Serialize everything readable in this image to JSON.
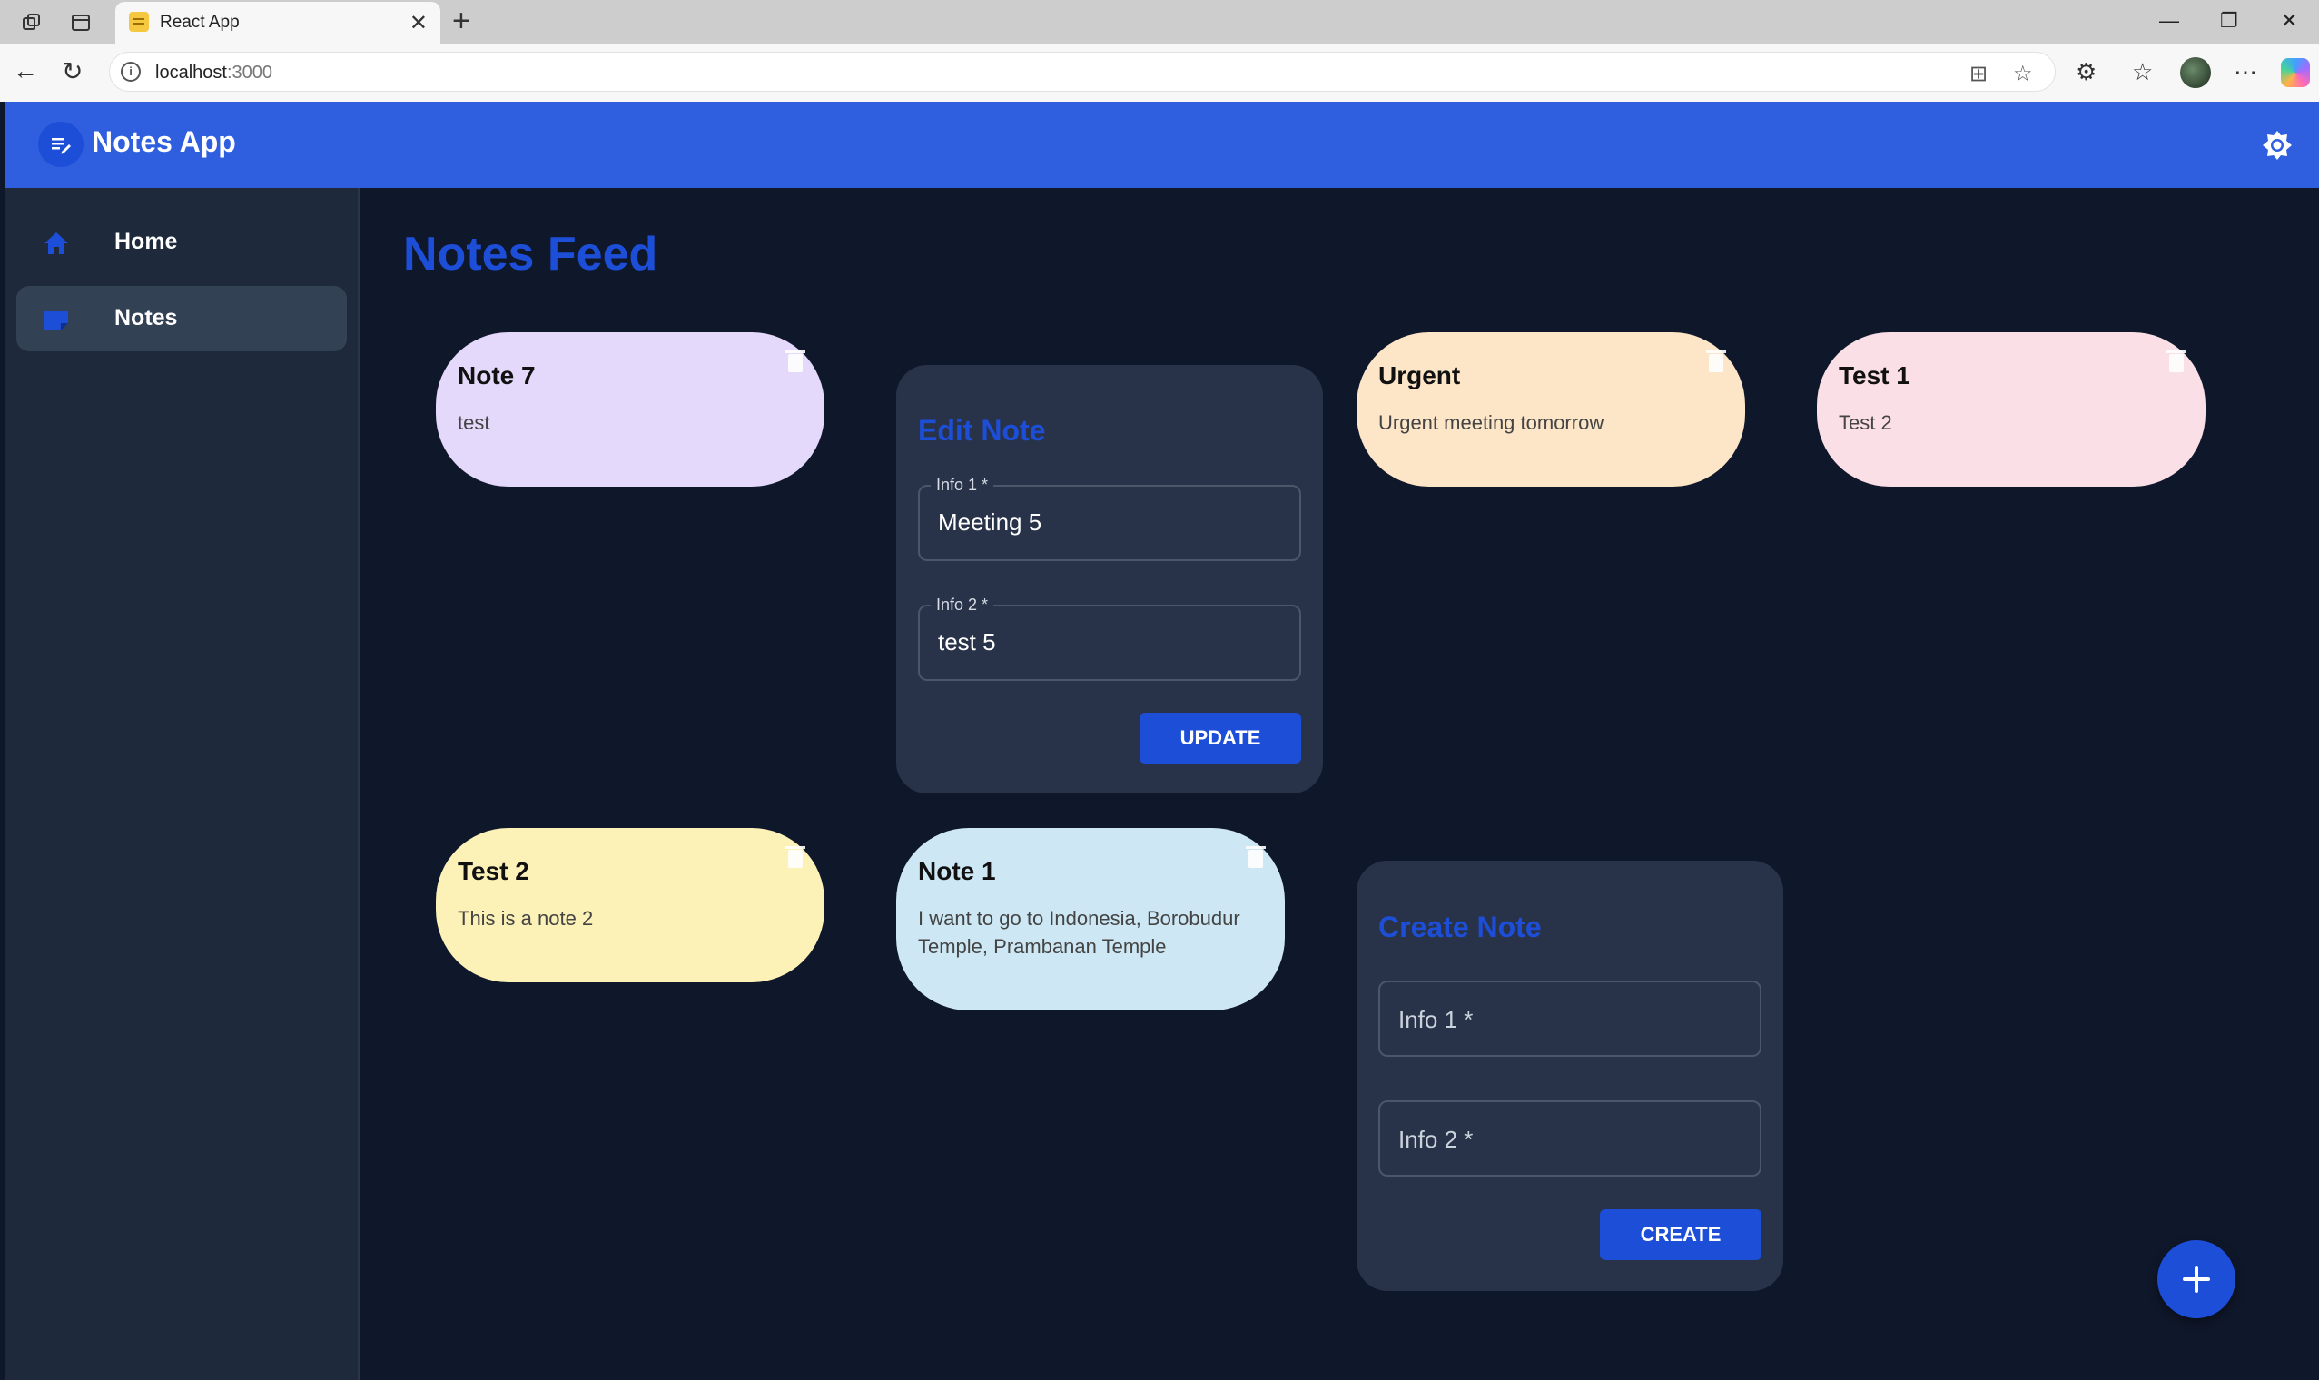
{
  "browser": {
    "tab_title": "React App",
    "url_host": "localhost",
    "url_port": ":3000"
  },
  "app": {
    "title": "Notes App"
  },
  "sidebar": {
    "items": [
      {
        "label": "Home",
        "icon": "home-icon"
      },
      {
        "label": "Notes",
        "icon": "note-icon",
        "active": true
      }
    ]
  },
  "feed": {
    "title": "Notes Feed",
    "notes": [
      {
        "title": "Note 7",
        "body": "test",
        "color": "#e4d8fb"
      },
      {
        "title": "Urgent",
        "body": "Urgent meeting tomorrow",
        "color": "#fde6c8"
      },
      {
        "title": "Test 1",
        "body": "Test 2",
        "color": "#fbdfe6"
      },
      {
        "title": "Test 2",
        "body": "This is a note 2",
        "color": "#fcf2b7"
      },
      {
        "title": "Note 1",
        "body": "I want to go to Indonesia, Borobudur Temple, Prambanan Temple",
        "color": "#cde8f4"
      }
    ]
  },
  "edit_form": {
    "title": "Edit Note",
    "field1_label": "Info 1 *",
    "field1_value": "Meeting 5",
    "field2_label": "Info 2 *",
    "field2_value": "test 5",
    "button": "UPDATE"
  },
  "create_form": {
    "title": "Create Note",
    "field1_placeholder": "Info 1 *",
    "field2_placeholder": "Info 2 *",
    "button": "CREATE"
  },
  "colors": {
    "appbar": "#2f5fde",
    "accent": "#1d4ed8",
    "background": "#0f172a",
    "sidebar": "#1e293b"
  }
}
